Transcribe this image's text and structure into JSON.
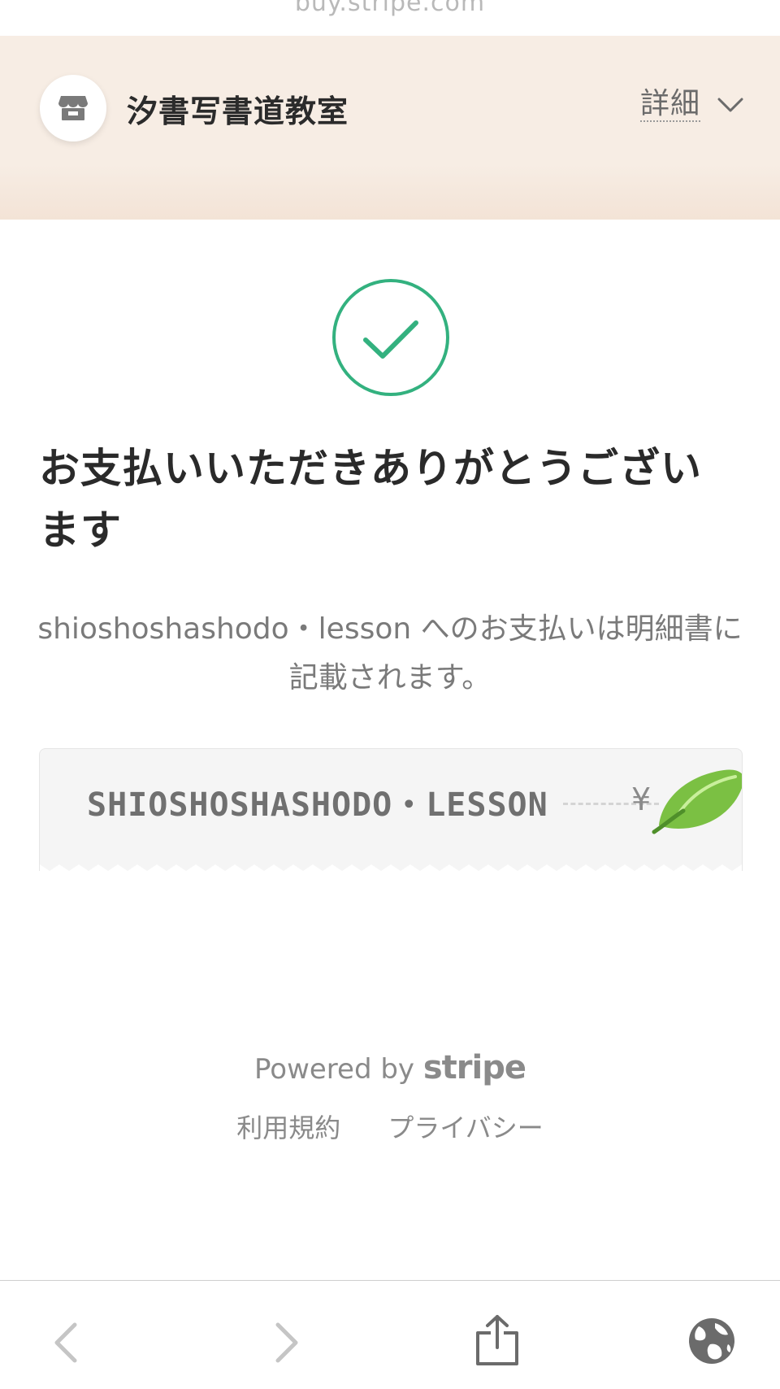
{
  "browser": {
    "url_text": "buy.stripe.com"
  },
  "header": {
    "merchant_name": "汐書写書道教室",
    "details_label": "詳細",
    "background_color": "#f7ede4"
  },
  "main": {
    "success_color": "#33b17f",
    "title": "お支払いいただきありがとうございます",
    "statement_note": "shioshoshashodo・lesson へのお支払いは明細書に記載されます。"
  },
  "receipt": {
    "descriptor": "SHIOSHOSHASHODO・LESSON",
    "amount_prefix": "¥"
  },
  "footer": {
    "powered_by": "Powered by",
    "brand": "stripe",
    "links": [
      "利用規約",
      "プライバシー"
    ]
  },
  "icons": {
    "store": "store-icon",
    "chevron": "chevron-down-icon",
    "check": "check-circle-icon",
    "leaf": "leaf-icon",
    "back": "back-icon",
    "forward": "forward-icon",
    "share": "share-icon",
    "globe": "globe-icon"
  }
}
